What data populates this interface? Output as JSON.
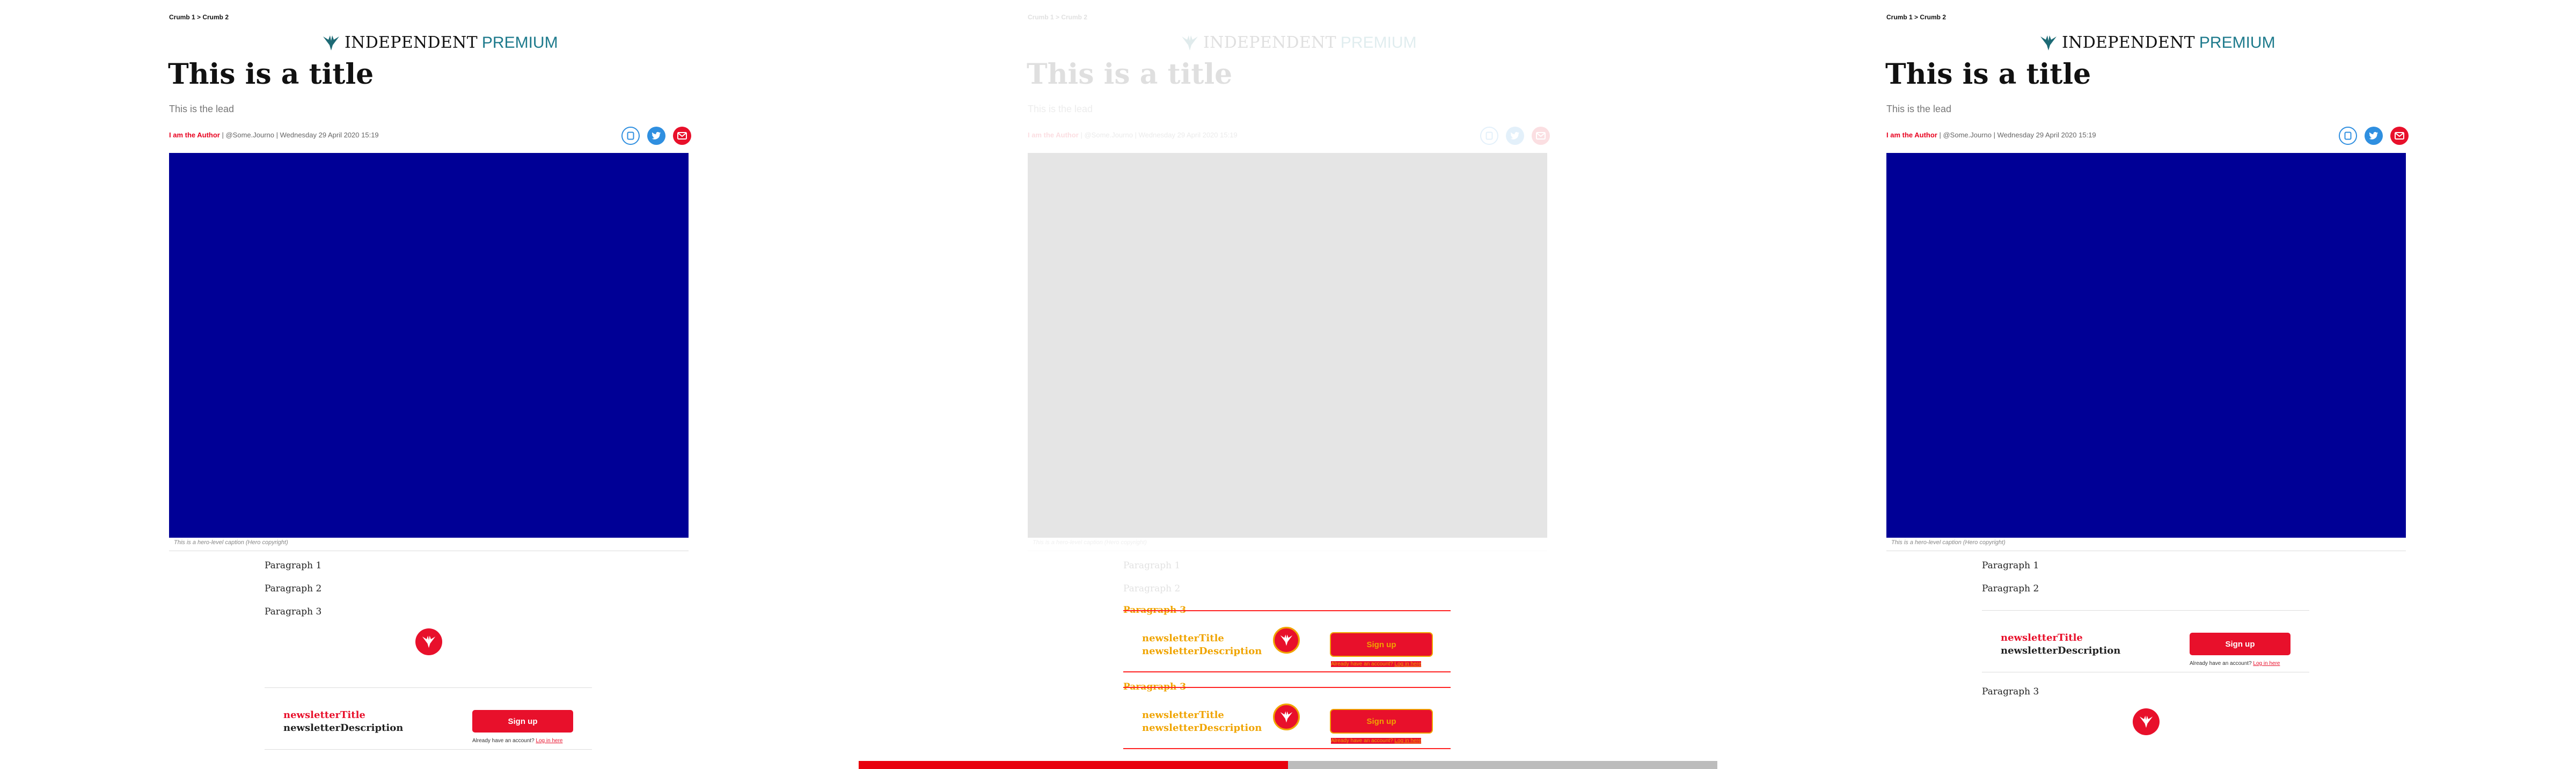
{
  "breadcrumb": "Crumb 1 > Crumb 2",
  "logo": {
    "brand": "INDEPENDENT",
    "tier": "PREMIUM"
  },
  "article": {
    "title": "This is a title",
    "lead": "This is the lead",
    "author": "I am the Author",
    "byline_rest": "| @Some.Journo | Wednesday 29 April 2020 15:19",
    "hero_caption": "This is a hero-level caption (Hero copyright)"
  },
  "paragraphs": [
    "Paragraph 1",
    "Paragraph 2",
    "Paragraph 3"
  ],
  "newsletter": {
    "title": "newsletterTitle",
    "description": "newsletterDescription",
    "signup_label": "Sign up",
    "login_prefix": "Already have an account?",
    "login_link": "Log in here"
  },
  "share_icons": [
    "bookmark-icon",
    "twitter-icon",
    "email-icon"
  ],
  "colors": {
    "accent_red": "#e8102b",
    "hero_blue": "#000096",
    "premium_teal": "#1d7a8c",
    "highlight_orange": "#f0a400",
    "progress_red": "#e8000d"
  },
  "progress": {
    "fraction": 0.5
  }
}
